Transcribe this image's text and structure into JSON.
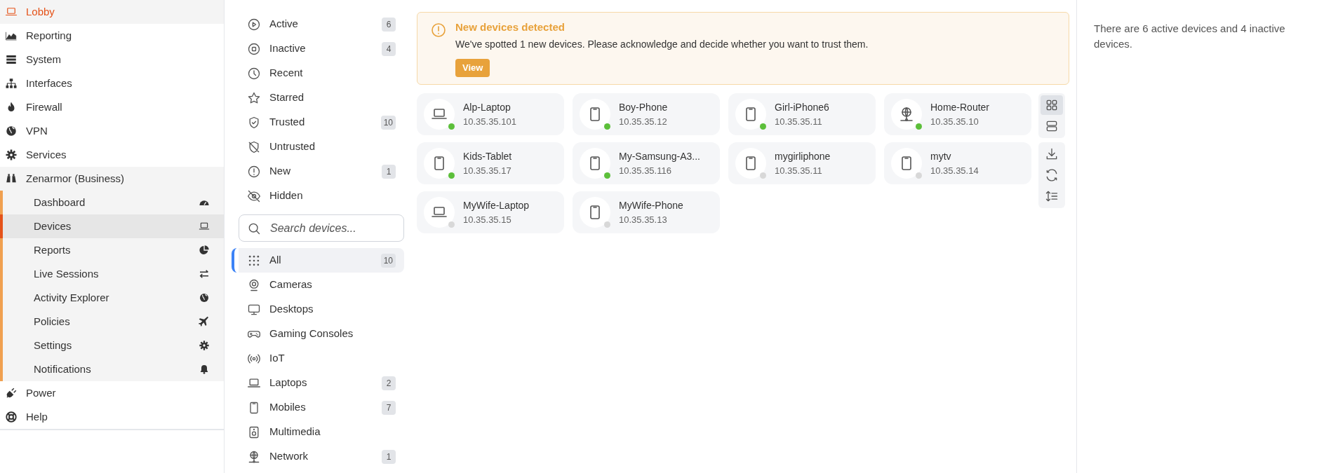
{
  "sidebar": {
    "items": [
      {
        "label": "Lobby",
        "selected": true
      },
      {
        "label": "Reporting",
        "selected": false
      },
      {
        "label": "System",
        "selected": false
      },
      {
        "label": "Interfaces",
        "selected": false
      },
      {
        "label": "Firewall",
        "selected": false
      },
      {
        "label": "VPN",
        "selected": false
      },
      {
        "label": "Services",
        "selected": false
      },
      {
        "label": "Zenarmor (Business)",
        "selected": false,
        "expanded": true,
        "children": [
          {
            "label": "Dashboard",
            "selected": false
          },
          {
            "label": "Devices",
            "selected": true
          },
          {
            "label": "Reports",
            "selected": false
          },
          {
            "label": "Live Sessions",
            "selected": false
          },
          {
            "label": "Activity Explorer",
            "selected": false
          },
          {
            "label": "Policies",
            "selected": false
          },
          {
            "label": "Settings",
            "selected": false
          },
          {
            "label": "Notifications",
            "selected": false
          }
        ]
      },
      {
        "label": "Power",
        "selected": false
      },
      {
        "label": "Help",
        "selected": false
      }
    ]
  },
  "status_filters": [
    {
      "label": "Active",
      "count": "6",
      "selected": false
    },
    {
      "label": "Inactive",
      "count": "4",
      "selected": false
    },
    {
      "label": "Recent",
      "selected": false
    },
    {
      "label": "Starred",
      "selected": false
    },
    {
      "label": "Trusted",
      "count": "10",
      "selected": false
    },
    {
      "label": "Untrusted",
      "selected": false
    },
    {
      "label": "New",
      "count": "1",
      "selected": false
    },
    {
      "label": "Hidden",
      "selected": false
    }
  ],
  "search": {
    "placeholder": "Search devices..."
  },
  "categories": [
    {
      "label": "All",
      "count": "10",
      "selected": true
    },
    {
      "label": "Cameras",
      "selected": false
    },
    {
      "label": "Desktops",
      "selected": false
    },
    {
      "label": "Gaming Consoles",
      "selected": false
    },
    {
      "label": "IoT",
      "selected": false
    },
    {
      "label": "Laptops",
      "count": "2",
      "selected": false
    },
    {
      "label": "Mobiles",
      "count": "7",
      "selected": false
    },
    {
      "label": "Multimedia",
      "selected": false
    },
    {
      "label": "Network",
      "count": "1",
      "selected": false
    }
  ],
  "alert": {
    "title": "New devices detected",
    "message": "We've spotted 1 new devices. Please acknowledge and decide whether you want to trust them.",
    "button": "View"
  },
  "devices": [
    {
      "name": "Alp-Laptop",
      "ip": "10.35.35.101",
      "kind": "laptop",
      "active": true
    },
    {
      "name": "Boy-Phone",
      "ip": "10.35.35.12",
      "kind": "phone",
      "active": true
    },
    {
      "name": "Girl-iPhone6",
      "ip": "10.35.35.11",
      "kind": "phone",
      "active": true
    },
    {
      "name": "Home-Router",
      "ip": "10.35.35.10",
      "kind": "router",
      "active": true
    },
    {
      "name": "Kids-Tablet",
      "ip": "10.35.35.17",
      "kind": "phone",
      "active": true
    },
    {
      "name": "My-Samsung-A3...",
      "ip": "10.35.35.116",
      "kind": "phone",
      "active": true
    },
    {
      "name": "mygirliphone",
      "ip": "10.35.35.11",
      "kind": "phone",
      "active": false
    },
    {
      "name": "mytv",
      "ip": "10.35.35.14",
      "kind": "phone",
      "active": false
    },
    {
      "name": "MyWife-Laptop",
      "ip": "10.35.35.15",
      "kind": "laptop",
      "active": false
    },
    {
      "name": "MyWife-Phone",
      "ip": "10.35.35.13",
      "kind": "phone",
      "active": false
    }
  ],
  "view_modes": [
    {
      "selected": true
    },
    {
      "selected": false
    }
  ],
  "summary": "There are 6 active devices and 4 inactive devices."
}
